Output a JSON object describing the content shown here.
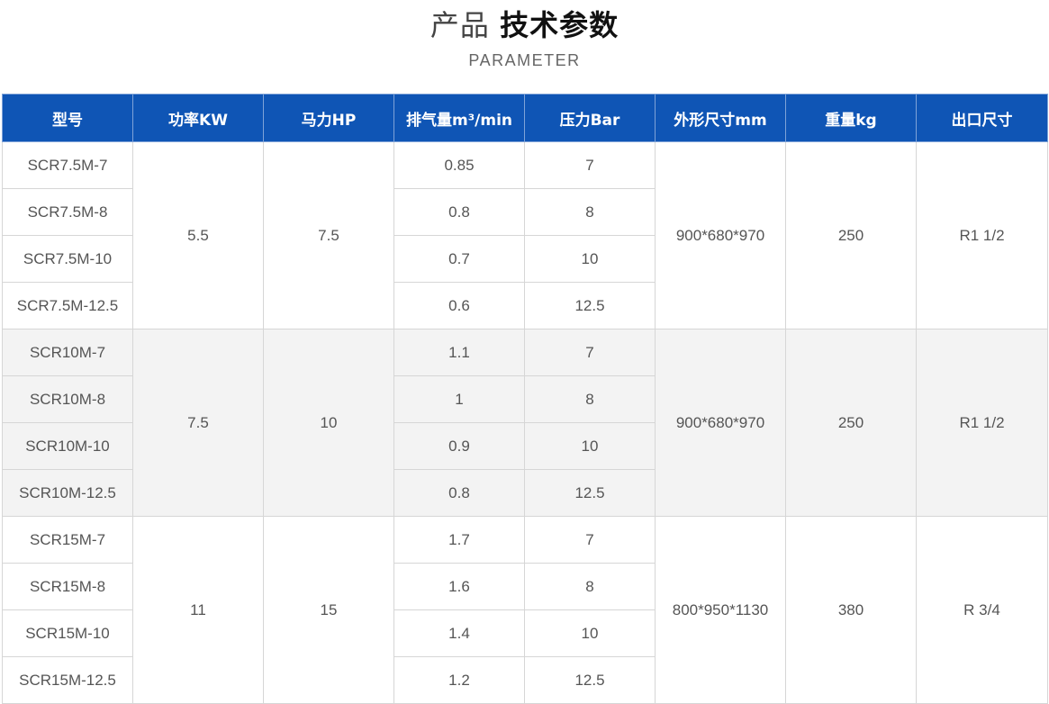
{
  "header": {
    "title_light": "产品",
    "title_bold": "技术参数",
    "subtitle": "PARAMETER"
  },
  "table": {
    "columns": [
      "型号",
      "功率KW",
      "马力HP",
      "排气量m³/min",
      "压力Bar",
      "外形尺寸mm",
      "重量kg",
      "出口尺寸"
    ],
    "groups": [
      {
        "power_kw": "5.5",
        "horsepower": "7.5",
        "dimensions": "900*680*970",
        "weight": "250",
        "outlet": "R1 1/2",
        "rows": [
          {
            "model": "SCR7.5M-7",
            "displacement": "0.85",
            "pressure": "7"
          },
          {
            "model": "SCR7.5M-8",
            "displacement": "0.8",
            "pressure": "8"
          },
          {
            "model": "SCR7.5M-10",
            "displacement": "0.7",
            "pressure": "10"
          },
          {
            "model": "SCR7.5M-12.5",
            "displacement": "0.6",
            "pressure": "12.5"
          }
        ]
      },
      {
        "power_kw": "7.5",
        "horsepower": "10",
        "dimensions": "900*680*970",
        "weight": "250",
        "outlet": "R1 1/2",
        "rows": [
          {
            "model": "SCR10M-7",
            "displacement": "1.1",
            "pressure": "7"
          },
          {
            "model": "SCR10M-8",
            "displacement": "1",
            "pressure": "8"
          },
          {
            "model": "SCR10M-10",
            "displacement": "0.9",
            "pressure": "10"
          },
          {
            "model": "SCR10M-12.5",
            "displacement": "0.8",
            "pressure": "12.5"
          }
        ]
      },
      {
        "power_kw": "11",
        "horsepower": "15",
        "dimensions": "800*950*1130",
        "weight": "380",
        "outlet": "R 3/4",
        "rows": [
          {
            "model": "SCR15M-7",
            "displacement": "1.7",
            "pressure": "7"
          },
          {
            "model": "SCR15M-8",
            "displacement": "1.6",
            "pressure": "8"
          },
          {
            "model": "SCR15M-10",
            "displacement": "1.4",
            "pressure": "10"
          },
          {
            "model": "SCR15M-12.5",
            "displacement": "1.2",
            "pressure": "12.5"
          }
        ]
      }
    ]
  },
  "colors": {
    "header_bg": "#0f55b5",
    "alt_group_bg": "#f3f3f3"
  }
}
